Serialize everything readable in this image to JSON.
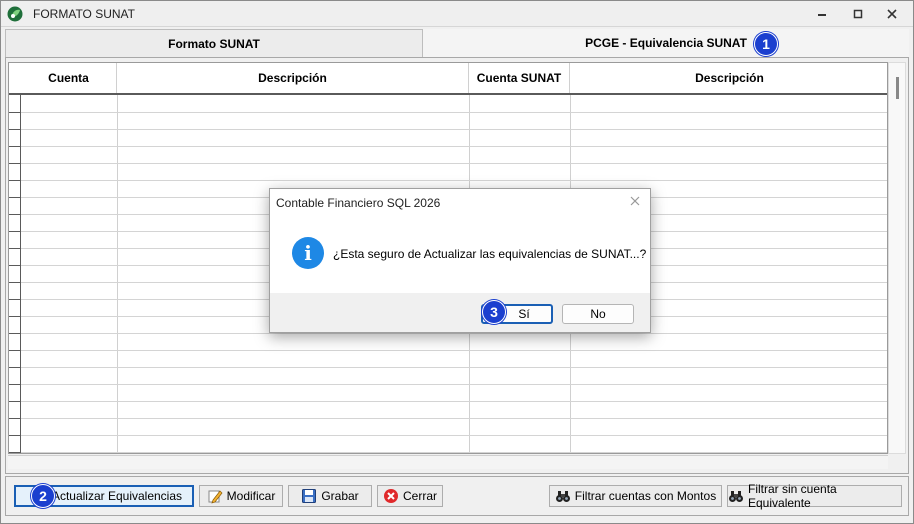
{
  "window": {
    "title": "FORMATO SUNAT"
  },
  "tabs": [
    {
      "label": "Formato SUNAT"
    },
    {
      "label": "PCGE - Equivalencia SUNAT"
    }
  ],
  "grid": {
    "columns": [
      "Cuenta",
      "Descripción",
      "Cuenta SUNAT",
      "Descripción"
    ],
    "rows": []
  },
  "toolbar": {
    "actualizar_label": "Actualizar Equivalencias",
    "modificar_label": "Modificar",
    "grabar_label": "Grabar",
    "cerrar_label": "Cerrar",
    "filtrar_montos_label": "Filtrar cuentas con Montos",
    "filtrar_sin_equiv_label": "Filtrar sin cuenta Equivalente"
  },
  "dialog": {
    "title": "Contable Financiero SQL 2026",
    "message": "¿Esta seguro de Actualizar las equivalencias de SUNAT...?",
    "yes_label": "Sí",
    "no_label": "No"
  },
  "badges": [
    "1",
    "2",
    "3"
  ],
  "colors": {
    "badge": "#1b3fcf",
    "info_icon": "#1e88e5",
    "focus_border": "#1a5fb4"
  },
  "icons": {
    "app": "app-leaf-icon",
    "modificar": "edit-pencil-icon",
    "grabar": "floppy-disk-icon",
    "cerrar": "close-circle-icon",
    "filtrar": "binoculars-icon",
    "dialog": "info-icon"
  }
}
